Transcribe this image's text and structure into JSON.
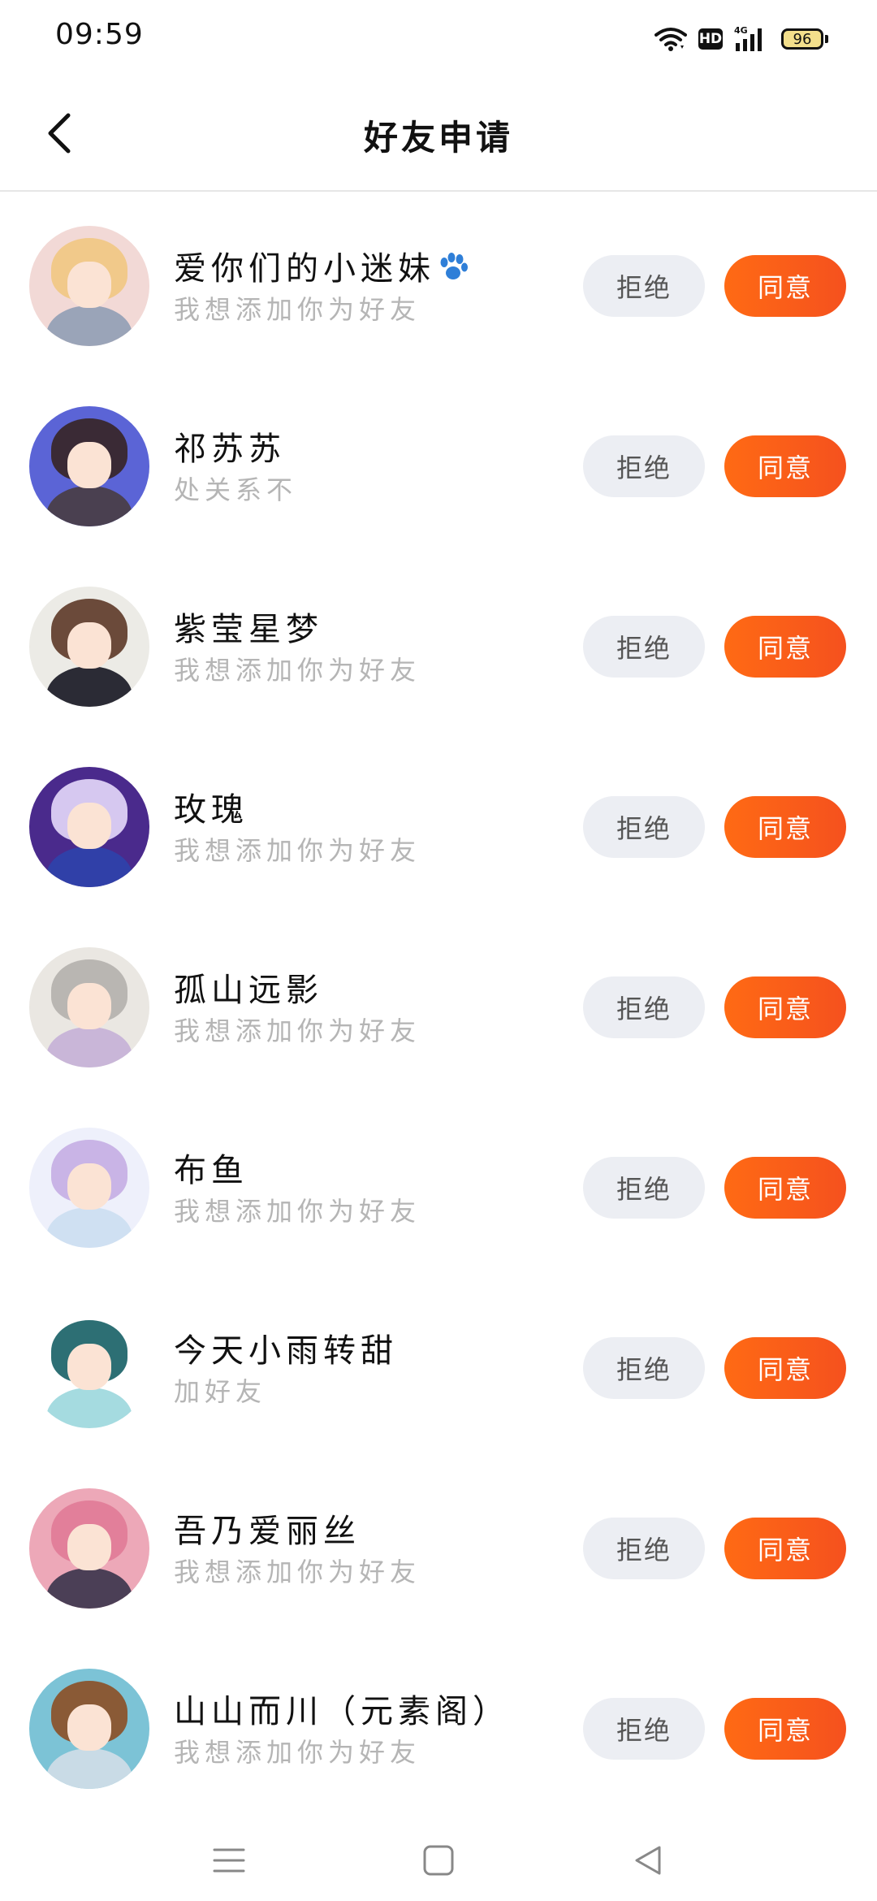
{
  "status_bar": {
    "time": "09:59",
    "network": "4G",
    "hd_label": "HD",
    "battery": "96"
  },
  "header": {
    "title": "好友申请"
  },
  "buttons": {
    "reject_label": "拒绝",
    "accept_label": "同意"
  },
  "requests": [
    {
      "name": "爱你们的小迷妹",
      "message": "我想添加你为好友",
      "has_paw": true
    },
    {
      "name": "祁苏苏",
      "message": "处关系不"
    },
    {
      "name": "紫莹星梦",
      "message": "我想添加你为好友"
    },
    {
      "name": "玫瑰",
      "message": "我想添加你为好友"
    },
    {
      "name": "孤山远影",
      "message": "我想添加你为好友"
    },
    {
      "name": "布鱼",
      "message": "我想添加你为好友"
    },
    {
      "name": "今天小雨转甜",
      "message": "加好友"
    },
    {
      "name": "吾乃爱丽丝",
      "message": "我想添加你为好友"
    },
    {
      "name": "山山而川（元素阁）",
      "message": "我想添加你为好友"
    }
  ],
  "colors": {
    "accent": "#f95a19",
    "reject_bg": "#eceef3",
    "message_text": "#b5b5b5",
    "paw": "#2f7fd8"
  },
  "icons": {
    "back": "chevron-left-icon",
    "paw": "paw-icon",
    "nav_menu": "menu-icon",
    "nav_home": "square-icon",
    "nav_back": "triangle-back-icon"
  }
}
